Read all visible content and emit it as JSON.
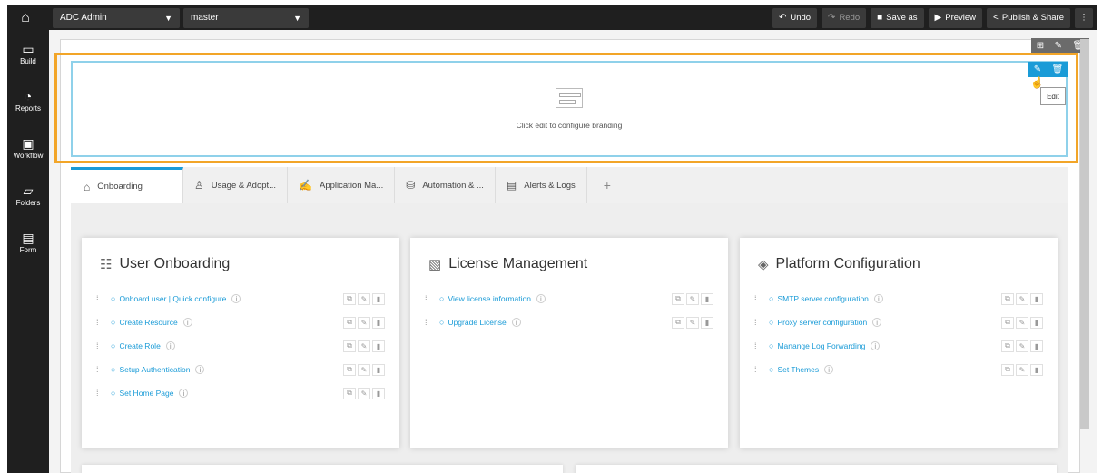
{
  "topbar": {
    "app_select": "ADC Admin",
    "branch_select": "master",
    "buttons": {
      "undo": "Undo",
      "redo": "Redo",
      "save_as": "Save as",
      "preview": "Preview",
      "publish": "Publish & Share"
    }
  },
  "sidebar": {
    "items": [
      {
        "label": "Build",
        "icon": "build-icon"
      },
      {
        "label": "Reports",
        "icon": "reports-icon"
      },
      {
        "label": "Workflow",
        "icon": "workflow-icon"
      },
      {
        "label": "Folders",
        "icon": "folders-icon"
      },
      {
        "label": "Form",
        "icon": "form-icon"
      }
    ]
  },
  "branding": {
    "text": "Click edit to configure branding",
    "tooltip": "Edit"
  },
  "tabs": [
    {
      "label": "Onboarding",
      "active": true
    },
    {
      "label": "Usage & Adopt..."
    },
    {
      "label": "Application Ma..."
    },
    {
      "label": "Automation & ..."
    },
    {
      "label": "Alerts & Logs"
    }
  ],
  "cards": [
    {
      "title": "User Onboarding",
      "items": [
        "Onboard user | Quick configure",
        "Create Resource",
        "Create Role",
        "Setup Authentication",
        "Set Home Page"
      ]
    },
    {
      "title": "License Management",
      "items": [
        "View license information",
        "Upgrade License"
      ]
    },
    {
      "title": "Platform Configuration",
      "items": [
        "SMTP server configuration",
        "Proxy server configuration",
        "Manange Log Forwarding",
        "Set Themes"
      ]
    }
  ],
  "colors": {
    "accent": "#1a9bd7",
    "highlight": "#f2a528",
    "topbar": "#1f1f1f"
  }
}
